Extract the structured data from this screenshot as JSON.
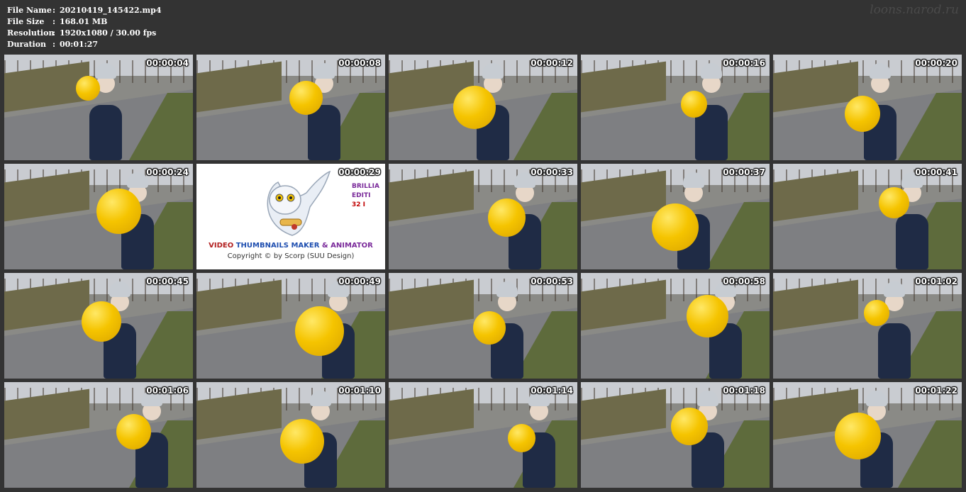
{
  "info": [
    {
      "label": "File Name",
      "value": "20210419_145422.mp4"
    },
    {
      "label": "File Size",
      "value": "168.01 MB"
    },
    {
      "label": "Resolution",
      "value": "1920x1080 / 30.00 fps"
    },
    {
      "label": "Duration",
      "value": "00:01:27"
    }
  ],
  "separator": ":",
  "watermark": "loons.narod.ru",
  "splash": {
    "title_part1": "VIDEO ",
    "title_part2": "THUMBNAILS MAKER",
    "title_part3": " & ANIMATOR",
    "copyright": "Copyright © by Scorp (SUU Design)",
    "edition_line1": "BRILLIA",
    "edition_line2": "EDITI",
    "edition_line3": "32 I"
  },
  "thumbnails": [
    {
      "time": "00:00:04"
    },
    {
      "time": "00:00:08"
    },
    {
      "time": "00:00:12"
    },
    {
      "time": "00:00:16"
    },
    {
      "time": "00:00:20"
    },
    {
      "time": "00:00:24"
    },
    {
      "time": "00:00:29",
      "splash": true
    },
    {
      "time": "00:00:33"
    },
    {
      "time": "00:00:37"
    },
    {
      "time": "00:00:41"
    },
    {
      "time": "00:00:45"
    },
    {
      "time": "00:00:49"
    },
    {
      "time": "00:00:53"
    },
    {
      "time": "00:00:58"
    },
    {
      "time": "00:01:02"
    },
    {
      "time": "00:01:06"
    },
    {
      "time": "00:01:10"
    },
    {
      "time": "00:01:14"
    },
    {
      "time": "00:01:18"
    },
    {
      "time": "00:01:22"
    }
  ],
  "colors": {
    "background": "#333333",
    "balloon": "#f5c400"
  }
}
